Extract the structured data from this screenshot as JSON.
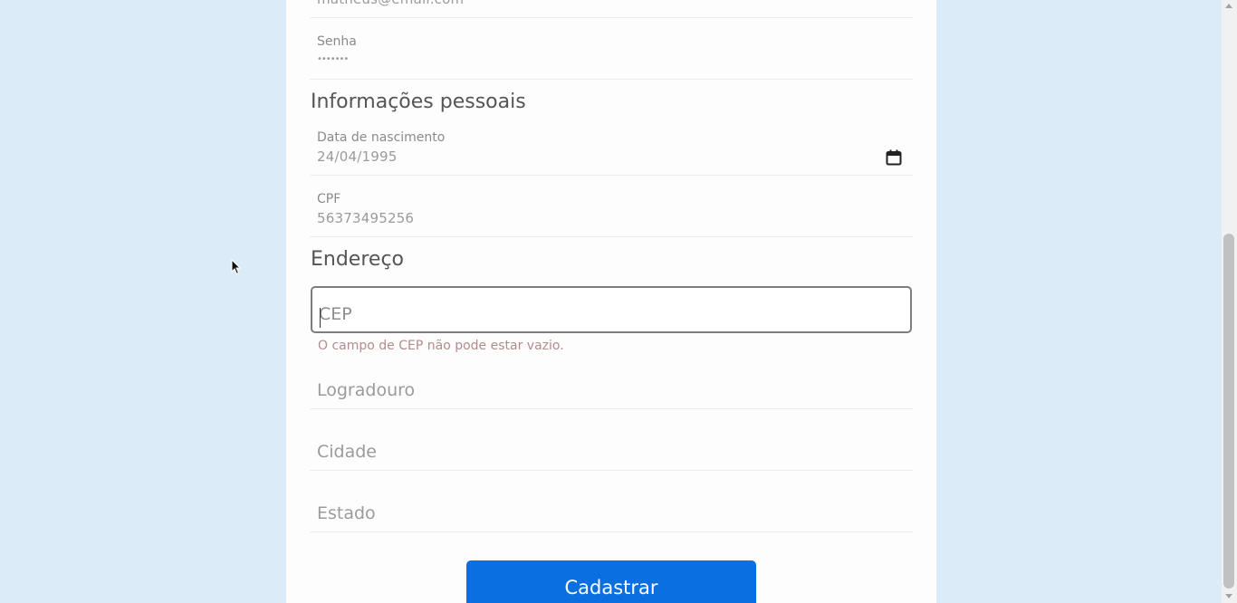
{
  "account": {
    "email_value": "matheus@email.com",
    "password_label": "Senha",
    "password_value": "•••••••"
  },
  "personal": {
    "section_title": "Informações pessoais",
    "birthdate_label": "Data de nascimento",
    "birthdate_value": "24/04/1995",
    "cpf_label": "CPF",
    "cpf_value": "56373495256"
  },
  "address": {
    "section_title": "Endereço",
    "cep_placeholder": "CEP",
    "cep_error": "O campo de CEP não pode estar vazio.",
    "street_placeholder": "Logradouro",
    "city_placeholder": "Cidade",
    "state_placeholder": "Estado"
  },
  "submit_label": "Cadastrar",
  "icons": {
    "date_picker": "calendar-icon",
    "pointer": "mouse-cursor-icon"
  }
}
